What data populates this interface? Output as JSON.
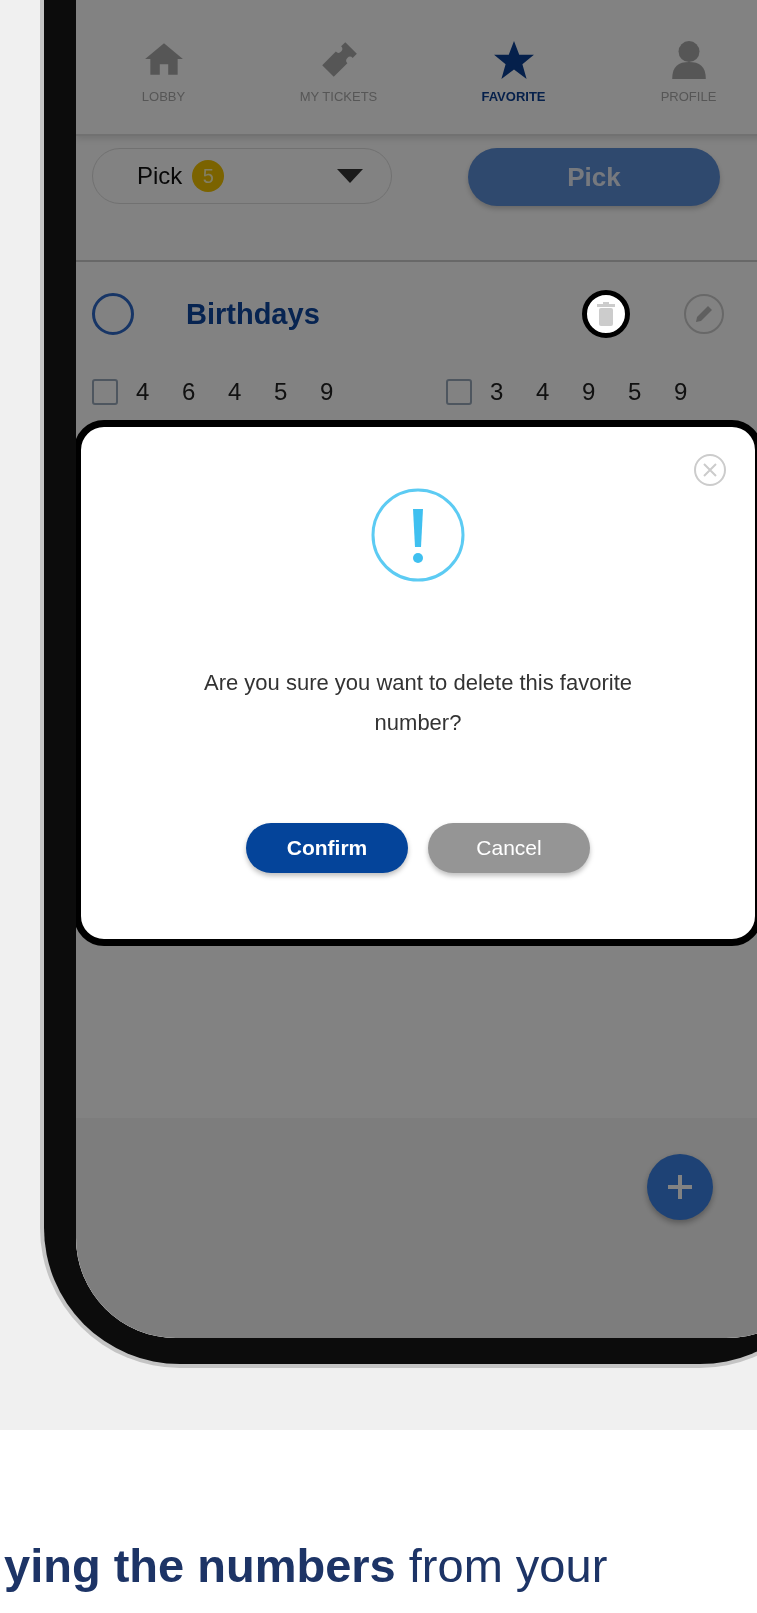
{
  "nav_tabs": [
    {
      "label": "LOBBY",
      "selected": false
    },
    {
      "label": "MY TICKETS",
      "selected": false
    },
    {
      "label": "FAVORITE",
      "selected": true
    },
    {
      "label": "PROFILE",
      "selected": false
    }
  ],
  "pick_dropdown": {
    "label": "Pick",
    "badge": "5"
  },
  "pick_button": "Pick",
  "favorite": {
    "name": "Birthdays",
    "selected": false,
    "delete_highlighted": true
  },
  "number_sets": [
    {
      "checked": false,
      "numbers": [
        "4",
        "6",
        "4",
        "5",
        "9"
      ]
    },
    {
      "checked": false,
      "numbers": [
        "3",
        "4",
        "9",
        "5",
        "9"
      ]
    }
  ],
  "dialog": {
    "message": "Are you sure you want to delete this favorite number?",
    "buttons": [
      {
        "label": "Confirm",
        "kind": "primary"
      },
      {
        "label": "Cancel",
        "kind": "secondary"
      }
    ]
  },
  "caption": "**ying the numbers** from your"
}
